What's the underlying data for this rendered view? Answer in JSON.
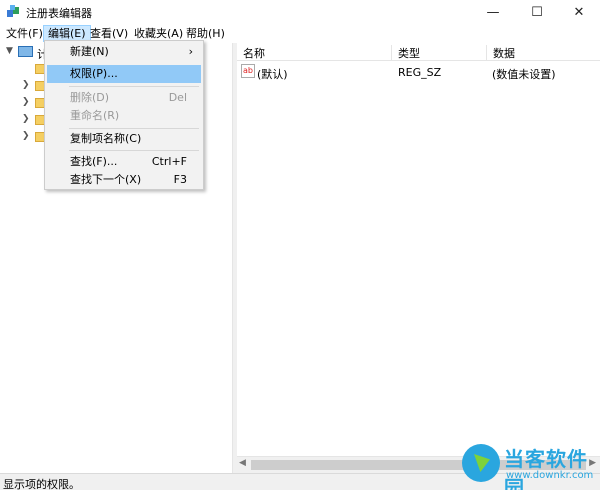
{
  "window": {
    "title": "注册表编辑器",
    "controls": {
      "minimize": "—",
      "maximize": "☐",
      "close": "✕"
    }
  },
  "menubar": {
    "items": [
      "文件(F)",
      "编辑(E)",
      "查看(V)",
      "收藏夹(A)",
      "帮助(H)"
    ],
    "active_index": 1
  },
  "tree": {
    "root_label": "计",
    "expand_arrow": "❯"
  },
  "list": {
    "columns": [
      "名称",
      "类型",
      "数据"
    ],
    "rows": [
      {
        "icon": "ab",
        "name": "(默认)",
        "type": "REG_SZ",
        "data": "(数值未设置)"
      }
    ]
  },
  "edit_menu": {
    "items": [
      {
        "label": "新建(N)",
        "shortcut": "",
        "submenu": "›",
        "state": "normal"
      },
      {
        "label": "权限(P)...",
        "shortcut": "",
        "state": "highlighted"
      },
      {
        "label": "删除(D)",
        "shortcut": "Del",
        "state": "disabled"
      },
      {
        "label": "重命名(R)",
        "shortcut": "",
        "state": "disabled"
      },
      {
        "label": "复制项名称(C)",
        "shortcut": "",
        "state": "normal"
      },
      {
        "label": "查找(F)...",
        "shortcut": "Ctrl+F",
        "state": "normal"
      },
      {
        "label": "查找下一个(X)",
        "shortcut": "F3",
        "state": "normal"
      }
    ]
  },
  "statusbar": {
    "text": "显示项的权限。"
  },
  "watermark": {
    "name": "当客软件园",
    "url": "www.downkr.com"
  },
  "colors": {
    "highlight": "#91c9f7",
    "menu_active": "#cce8ff",
    "folder": "#f5cf62",
    "watermark": "#2aa6df"
  }
}
